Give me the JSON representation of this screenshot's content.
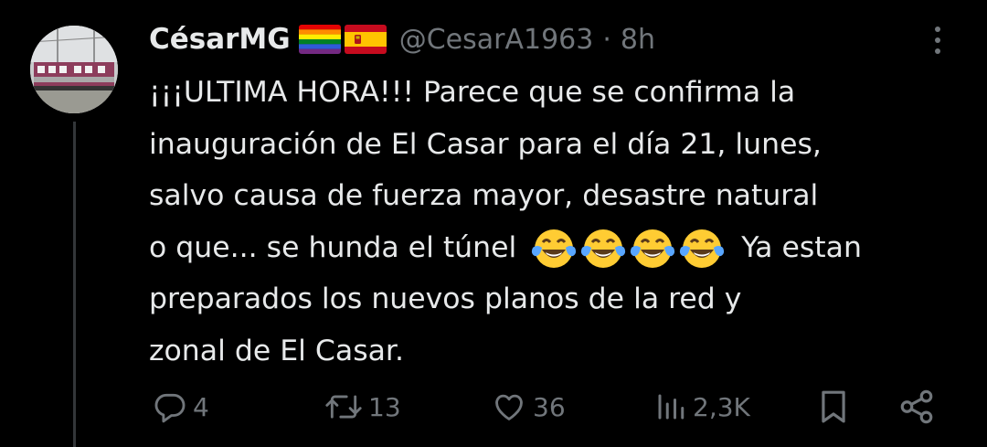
{
  "tweet": {
    "author_name": "CésarMG",
    "author_handle": "@CesarA1963",
    "separator": "·",
    "time": "8h",
    "flags": [
      "rainbow-flag-icon",
      "spain-flag-icon"
    ],
    "text_lines": [
      "¡¡¡ULTIMA HORA!!! Parece que se confirma la",
      "inauguración de El Casar para el día 21, lunes,",
      "salvo causa de fuerza mayor, desastre natural",
      "o que... se hunda el túnel",
      "Ya estan",
      "preparados los nuevos planos de la red y",
      "zonal de El Casar."
    ],
    "emoji_name": "face-with-tears-of-joy-icon",
    "emoji_count": 4
  },
  "actions": {
    "replies": "4",
    "reposts": "13",
    "likes": "36",
    "views": "2,3K"
  },
  "colors": {
    "background": "#000000",
    "text": "#e7e9ea",
    "secondary": "#71767b",
    "thread_line": "#333639"
  }
}
